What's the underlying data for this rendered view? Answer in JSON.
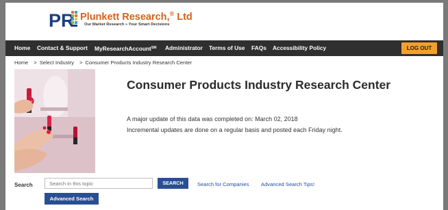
{
  "header": {
    "logo_mark": "PR",
    "company_name": "Plunkett Research,",
    "company_suffix": "Ltd",
    "registered_mark": "®",
    "tagline": "Our Market Research » Your Smart Decisions"
  },
  "nav": {
    "items": [
      {
        "label": "Home"
      },
      {
        "label": "Contact & Support"
      },
      {
        "label": "MyResearchAccount",
        "sup": "SM"
      },
      {
        "label": "Administrator"
      },
      {
        "label": "Terms of Use"
      },
      {
        "label": "FAQs"
      },
      {
        "label": "Accessibility Policy"
      }
    ],
    "logout_label": "LOG OUT"
  },
  "breadcrumb": {
    "items": [
      "Home",
      "Select Industry",
      "Consumer Products Industry Research Center"
    ],
    "separator": ">"
  },
  "main": {
    "title": "Consumer Products Industry Research Center",
    "update_line": "A major update of this data was completed on: March 02, 2018",
    "incremental_line": "Incremental updates are done on a regular basis and posted each Friday night."
  },
  "search": {
    "label": "Search",
    "placeholder": "Search in this topic",
    "button_label": "SEARCH",
    "companies_link": "Search for Companies",
    "tips_link": "Advanced Search Tips!",
    "advanced_label": "Advanced Search"
  },
  "colors": {
    "brand_orange": "#d7601a",
    "nav_bg": "#2f2f2f",
    "logout_bg": "#f2a12d",
    "button_blue": "#2a4e92",
    "link_blue": "#1f4ea8"
  }
}
